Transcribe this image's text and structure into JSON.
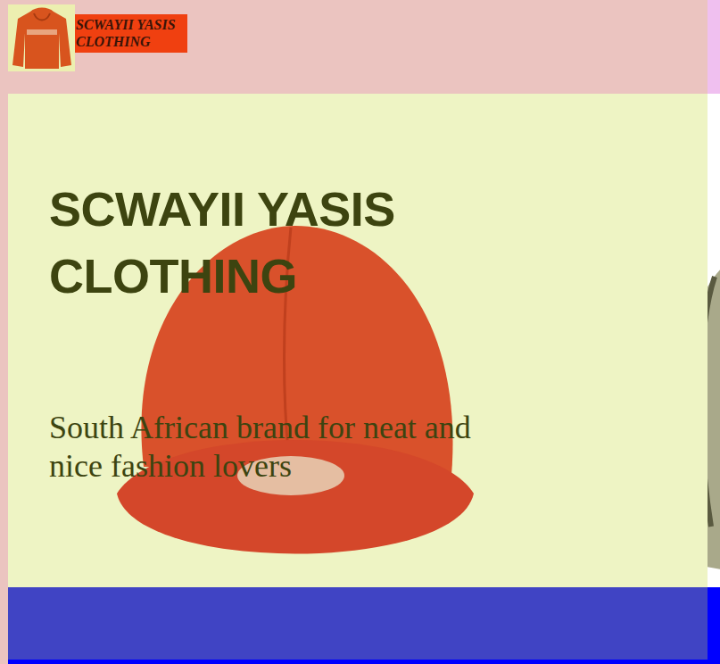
{
  "header": {
    "brand": "SCWAYII YASIS CLOTHING"
  },
  "hero": {
    "title": "SCWAYII YASIS CLOTHING",
    "subtitle": "South African brand for neat and nice fashion lovers"
  }
}
